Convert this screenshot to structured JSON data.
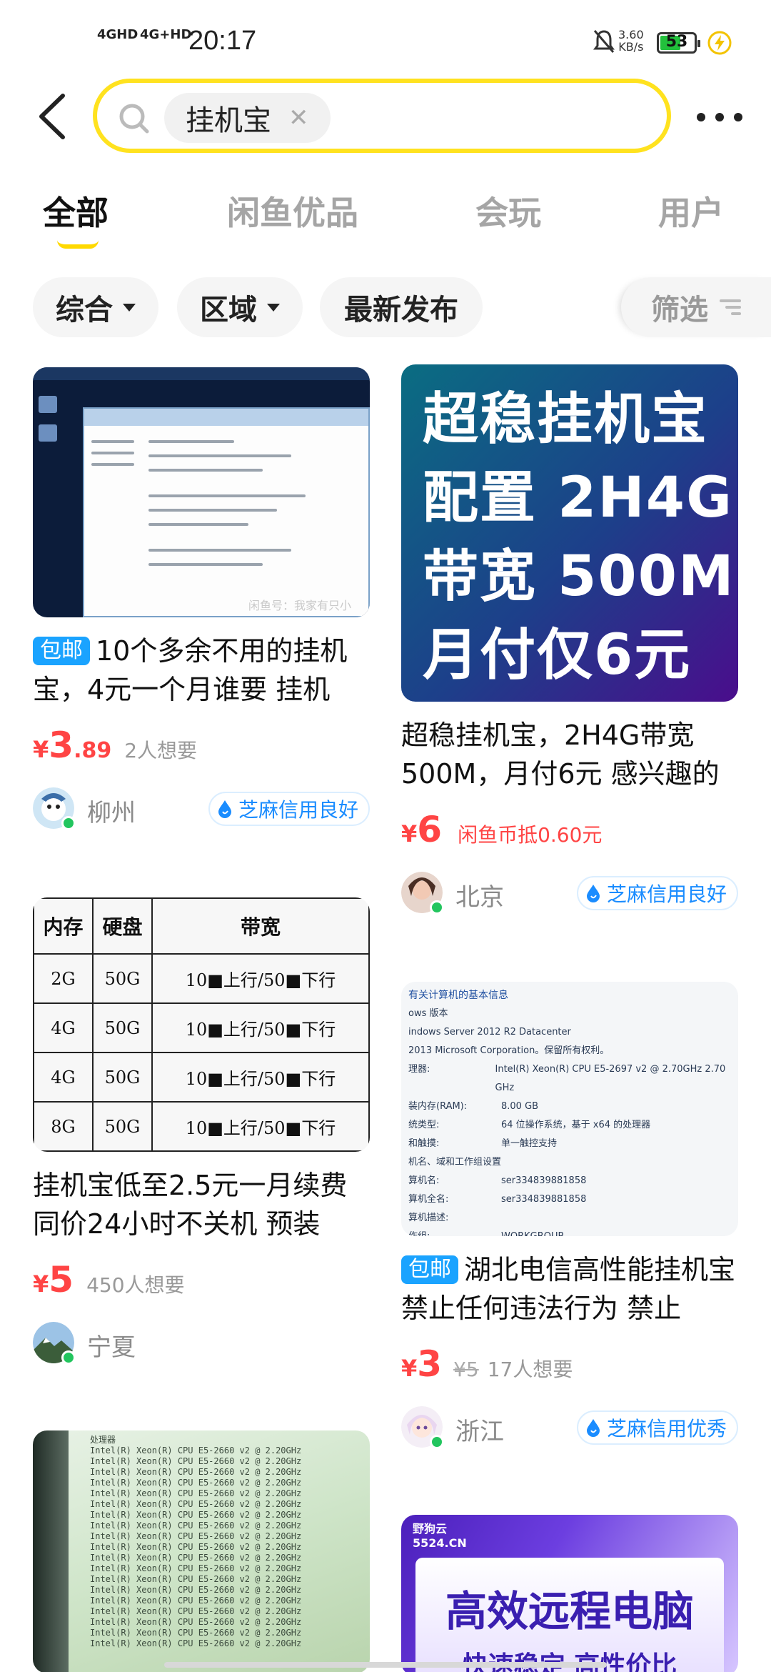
{
  "status_bar": {
    "signal1": "4GHD",
    "signal2": "4G+HD",
    "time": "20:17",
    "net_speed_value": "3.60",
    "net_speed_unit": "KB/s",
    "battery": "53"
  },
  "search": {
    "query": "挂机宝"
  },
  "tabs": [
    "全部",
    "闲鱼优品",
    "会玩",
    "用户"
  ],
  "filters": {
    "sort": "综合",
    "region": "区域",
    "latest": "最新发布",
    "screen": "筛选"
  },
  "products": [
    {
      "badge": "包邮",
      "title": "10个多余不用的挂机宝，4元一个月谁要 挂机",
      "price_int": "3",
      "price_dec": ".89",
      "want": "2人想要",
      "location": "柳州",
      "credit": "芝麻信用良好",
      "image_watermark": "闲鱼号：我家有只小"
    },
    {
      "title": "超稳挂机宝，2H4G带宽500M，月付6元 感兴趣的",
      "price_int": "6",
      "coin": "闲鱼币抵0.60元",
      "location": "北京",
      "credit": "芝麻信用良好",
      "image_text": [
        "超稳挂机宝",
        "配置 2H4G",
        "带宽 500M",
        "月付仅6元"
      ]
    },
    {
      "title": "挂机宝低至2.5元一月续费同价24小时不关机 预装",
      "price_int": "5",
      "want": "450人想要",
      "location": "宁夏",
      "image_table": {
        "headers": [
          "内存",
          "硬盘",
          "带宽"
        ],
        "rows": [
          [
            "2G",
            "50G",
            "10■上行/50■下行"
          ],
          [
            "4G",
            "50G",
            "10■上行/50■下行"
          ],
          [
            "4G",
            "50G",
            "10■上行/50■下行"
          ],
          [
            "8G",
            "50G",
            "10■上行/50■下行"
          ]
        ]
      }
    },
    {
      "badge": "包邮",
      "title": "湖北电信高性能挂机宝 禁止任何违法行为 禁止",
      "price_int": "3",
      "orig_price": "¥5",
      "want": "17人想要",
      "location": "浙江",
      "credit": "芝麻信用优秀",
      "image_info": {
        "heading": "有关计算机的基本信息",
        "lines": [
          "ows 版本",
          "indows Server 2012 R2 Datacenter",
          "2013 Microsoft Corporation。保留所有权利。"
        ],
        "specs": [
          [
            "理器:",
            "Intel(R) Xeon(R) CPU E5-2697 v2 @ 2.70GHz   2.70 GHz"
          ],
          [
            "装内存(RAM):",
            "8.00 GB"
          ],
          [
            "统类型:",
            "64 位操作系统，基于 x64 的处理器"
          ],
          [
            "和触摸:",
            "单一触控支持"
          ]
        ],
        "section": "机名、域和工作组设置",
        "names": [
          [
            "算机名:",
            "ser334839881858"
          ],
          [
            "算机全名:",
            "ser334839881858"
          ],
          [
            "算机描述:",
            ""
          ],
          [
            "作组:",
            "WORKGROUP"
          ]
        ]
      }
    },
    {
      "image_text": [
        "处理器"
      ]
    },
    {
      "image_logo": "野狗云 5524.CN",
      "image_text": [
        "高效远程电脑",
        "快速稳定 高性价比"
      ]
    }
  ]
}
